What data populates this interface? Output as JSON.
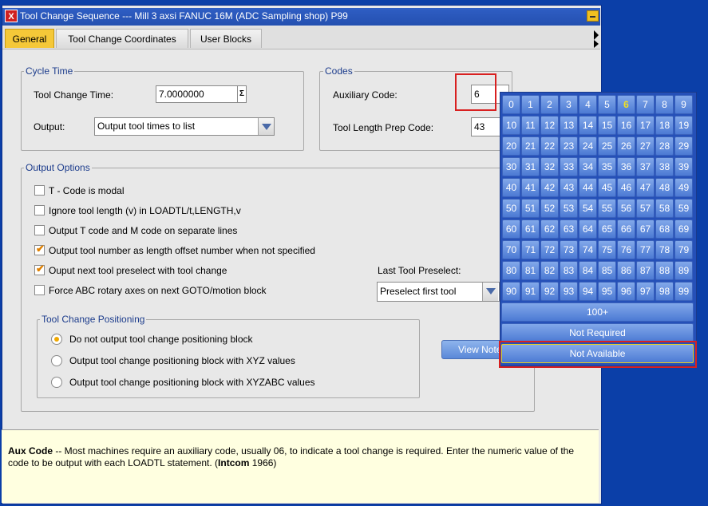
{
  "window": {
    "title": "Tool Change Sequence --- Mill 3 axsi FANUC 16M (ADC Sampling shop) P99",
    "icon": "app-icon"
  },
  "tabs": [
    "General",
    "Tool Change Coordinates",
    "User Blocks"
  ],
  "active_tab": "General",
  "cycle_time": {
    "legend": "Cycle Time",
    "tool_change_time_label": "Tool Change Time:",
    "tool_change_time_value": "7.0000000",
    "sigma": "Σ",
    "output_label": "Output:",
    "output_value": "Output tool times to list"
  },
  "codes": {
    "legend": "Codes",
    "aux_label": "Auxiliary Code:",
    "aux_value": "6",
    "prep_label": "Tool Length Prep Code:",
    "prep_value": "43"
  },
  "output_options": {
    "legend": "Output Options",
    "checkboxes": [
      {
        "label": "T - Code is modal",
        "checked": false
      },
      {
        "label": "Ignore tool length (v) in LOADTL/t,LENGTH,v",
        "checked": false
      },
      {
        "label": "Output T code and M code on separate lines",
        "checked": false
      },
      {
        "label": "Output tool number as length offset number when not specified",
        "checked": true
      },
      {
        "label": "Ouput next tool preselect with tool change",
        "checked": true
      },
      {
        "label": "Force ABC rotary axes on next GOTO/motion block",
        "checked": false
      }
    ],
    "last_tool_label": "Last Tool Preselect:",
    "last_tool_value": "Preselect first tool"
  },
  "positioning": {
    "legend": "Tool Change Positioning",
    "radios": [
      {
        "label": "Do not output tool change positioning block",
        "selected": true
      },
      {
        "label": "Output tool change positioning block with XYZ values",
        "selected": false
      },
      {
        "label": "Output tool change positioning block with XYZABC values",
        "selected": false
      }
    ]
  },
  "view_button": "View Note",
  "help": {
    "term": "Aux Code",
    "text1": " -- Most machines require an auxiliary code, usually 06, to indicate a tool change is required.  Enter the numeric value of the code to be output with each LOADTL statement.  (",
    "bold2": "Intcom",
    "text2": " 1966)"
  },
  "popup": {
    "numbers": [
      "0",
      "1",
      "2",
      "3",
      "4",
      "5",
      "6",
      "7",
      "8",
      "9",
      "10",
      "11",
      "12",
      "13",
      "14",
      "15",
      "16",
      "17",
      "18",
      "19",
      "20",
      "21",
      "22",
      "23",
      "24",
      "25",
      "26",
      "27",
      "28",
      "29",
      "30",
      "31",
      "32",
      "33",
      "34",
      "35",
      "36",
      "37",
      "38",
      "39",
      "40",
      "41",
      "42",
      "43",
      "44",
      "45",
      "46",
      "47",
      "48",
      "49",
      "50",
      "51",
      "52",
      "53",
      "54",
      "55",
      "56",
      "57",
      "58",
      "59",
      "60",
      "61",
      "62",
      "63",
      "64",
      "65",
      "66",
      "67",
      "68",
      "69",
      "70",
      "71",
      "72",
      "73",
      "74",
      "75",
      "76",
      "77",
      "78",
      "79",
      "80",
      "81",
      "82",
      "83",
      "84",
      "85",
      "86",
      "87",
      "88",
      "89",
      "90",
      "91",
      "92",
      "93",
      "94",
      "95",
      "96",
      "97",
      "98",
      "99"
    ],
    "selected": "6",
    "more_label": "100+",
    "not_required_label": "Not Required",
    "not_available_label": "Not Available"
  },
  "colors": {
    "accent_tab": "#f5c838",
    "popup_bg": "#2550b8",
    "highlight": "#d82020",
    "legend_text": "#1c3c8c"
  }
}
